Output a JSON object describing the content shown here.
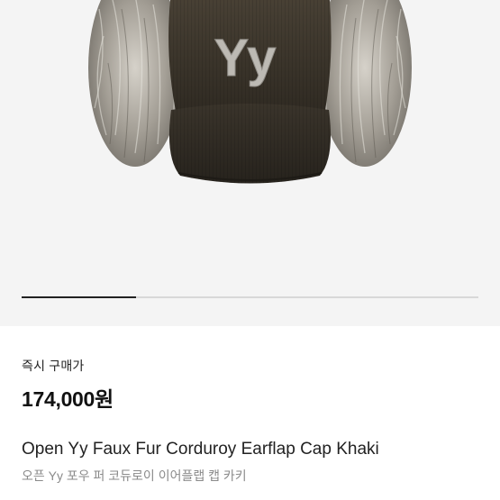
{
  "product": {
    "image_alt": "Open Yy Faux Fur Corduroy Earflap Cap Khaki",
    "logo_text": "Yy",
    "gallery_progress": 0.25,
    "price_label": "즉시 구매가",
    "price": "174,000원",
    "name_en": "Open Yy Faux Fur Corduroy Earflap Cap Khaki",
    "name_ko": "오픈 Yy 포우 퍼 코듀로이 이어플랩 캡 카키"
  },
  "colors": {
    "background": "#f4f4f4",
    "cap": "#3e372d",
    "fur": "#b9b4ab",
    "logo": "#bdbab4",
    "progress_track": "#d8d8d8",
    "progress_fill": "#222222"
  }
}
